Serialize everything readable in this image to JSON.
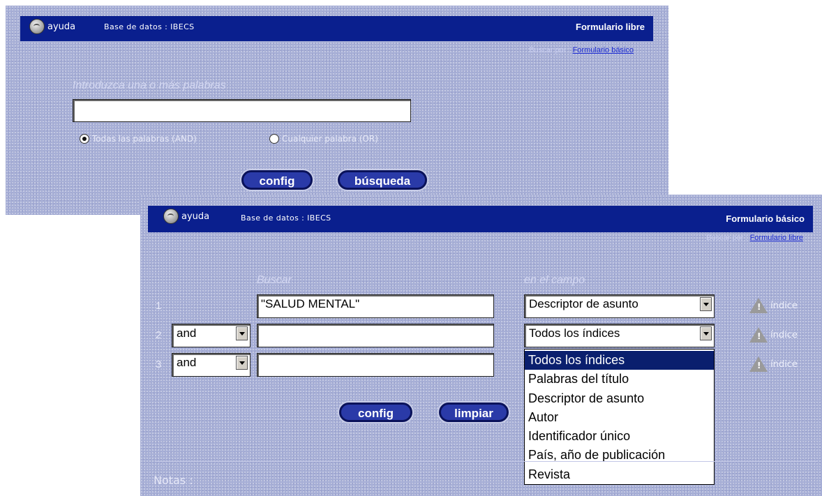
{
  "panel_free": {
    "help_label": "ayuda",
    "database": "Base de datos : IBECS",
    "form_title": "Formulario libre",
    "search_by_prefix": "Buscar por :",
    "search_by_link": "Formulario básico",
    "input_label": "Introduzca una o más palabras",
    "input_value": "",
    "radio_and": "Todas las palabras (AND)",
    "radio_or": "Cualquier palabra (OR)",
    "config_button": "config",
    "search_button": "búsqueda"
  },
  "panel_basic": {
    "help_label": "ayuda",
    "database": "Base de datos : IBECS",
    "form_title": "Formulario básico",
    "search_by_prefix": "Buscar por :",
    "search_by_link": "Formulario libre",
    "search_col_label": "Buscar",
    "field_col_label": "en el campo",
    "rows": [
      {
        "num": "1",
        "operator": "",
        "term": "\"SALUD MENTAL\"",
        "field": "Descriptor de asunto",
        "index_label": "índice"
      },
      {
        "num": "2",
        "operator": "and",
        "term": "",
        "field": "Todos los índices",
        "index_label": "índice"
      },
      {
        "num": "3",
        "operator": "and",
        "term": "",
        "field": "",
        "index_label": "índice"
      }
    ],
    "field_options": [
      "Todos los índices",
      "Palabras del título",
      "Descriptor de asunto",
      "Autor",
      "Identificador único",
      "País, año de publicación",
      "Revista"
    ],
    "selected_option_index": 0,
    "config_button": "config",
    "clear_button": "limpiar",
    "notes_label": "Notas :"
  }
}
